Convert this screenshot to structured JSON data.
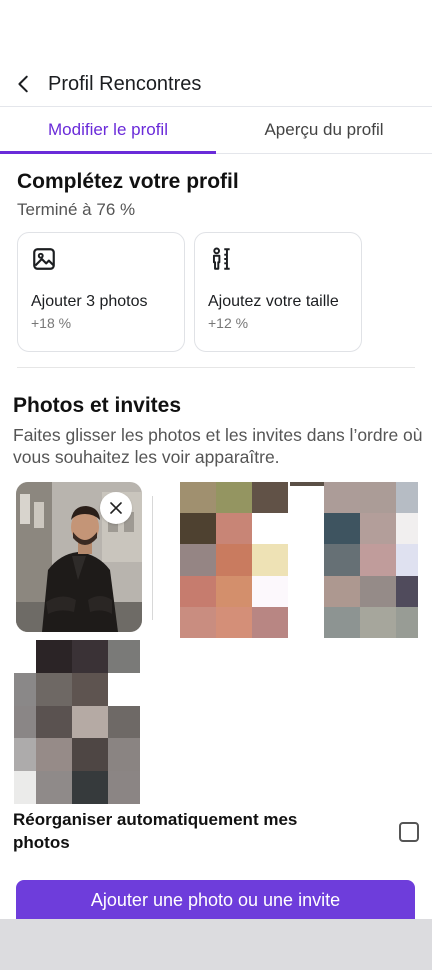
{
  "header": {
    "title": "Profil Rencontres"
  },
  "tabs": [
    {
      "label": "Modifier le profil",
      "active": true
    },
    {
      "label": "Aperçu du profil",
      "active": false
    }
  ],
  "complete": {
    "heading": "Complétez votre profil",
    "progress_text": "Terminé à 76 %",
    "progress_value": 76,
    "cards": [
      {
        "icon": "image-icon",
        "label": "Ajouter 3 photos",
        "pct": "+18 %"
      },
      {
        "icon": "height-icon",
        "label": "Ajoutez votre taille",
        "pct": "+12 %"
      }
    ]
  },
  "photos": {
    "heading": "Photos et invites",
    "description": "Faites glisser les photos et les invites dans l’ordre où vous souhaitez les voir apparaître."
  },
  "auto_arrange": {
    "label": "Réorganiser automatiquement mes photos",
    "checked": false
  },
  "cta": {
    "label": "Ajouter une photo ou une invite"
  },
  "colors": {
    "accent": "#6a2bd9",
    "button": "#6e3ddb"
  }
}
